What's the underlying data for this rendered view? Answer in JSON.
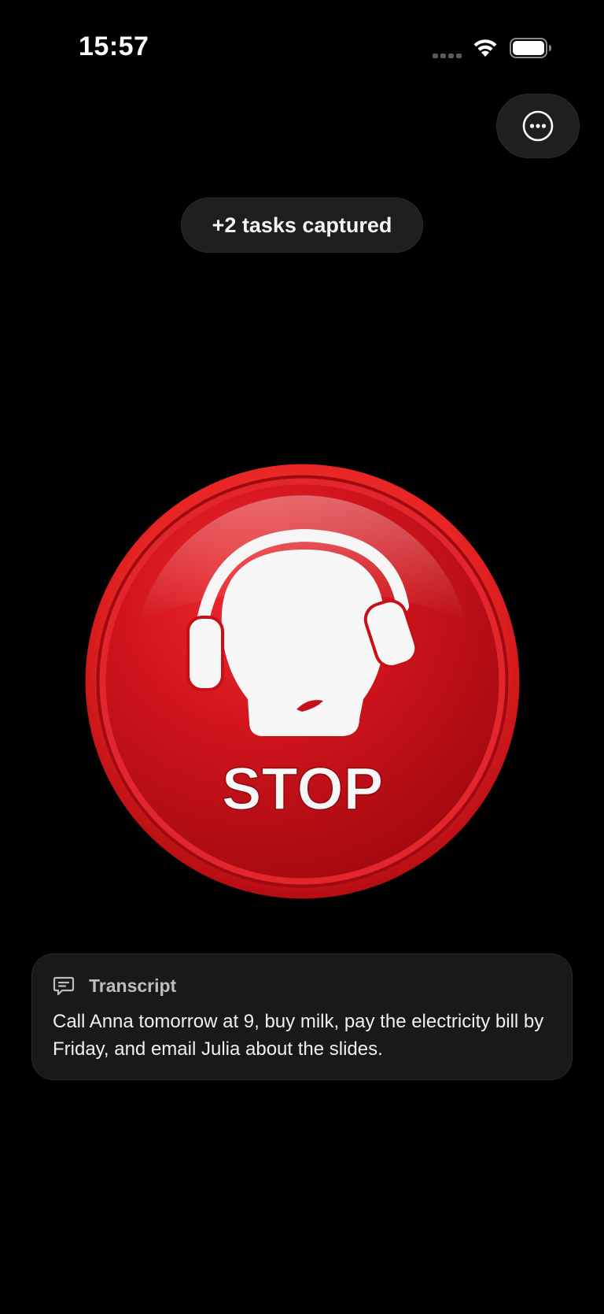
{
  "status_bar": {
    "time": "15:57"
  },
  "header": {
    "more_button_icon": "ellipsis-circle-icon"
  },
  "toast": {
    "text": "+2 tasks captured"
  },
  "stop_button": {
    "label": "STOP",
    "icon": "headphones-head-icon",
    "color": "#d1141c"
  },
  "transcript": {
    "icon": "chat-bubble-icon",
    "title": "Transcript",
    "text": "Call Anna tomorrow at 9, buy milk, pay the electricity bill by Friday, and email Julia about the slides."
  },
  "colors": {
    "background": "#000000",
    "card": "#191919",
    "accent_red": "#d1141c"
  }
}
